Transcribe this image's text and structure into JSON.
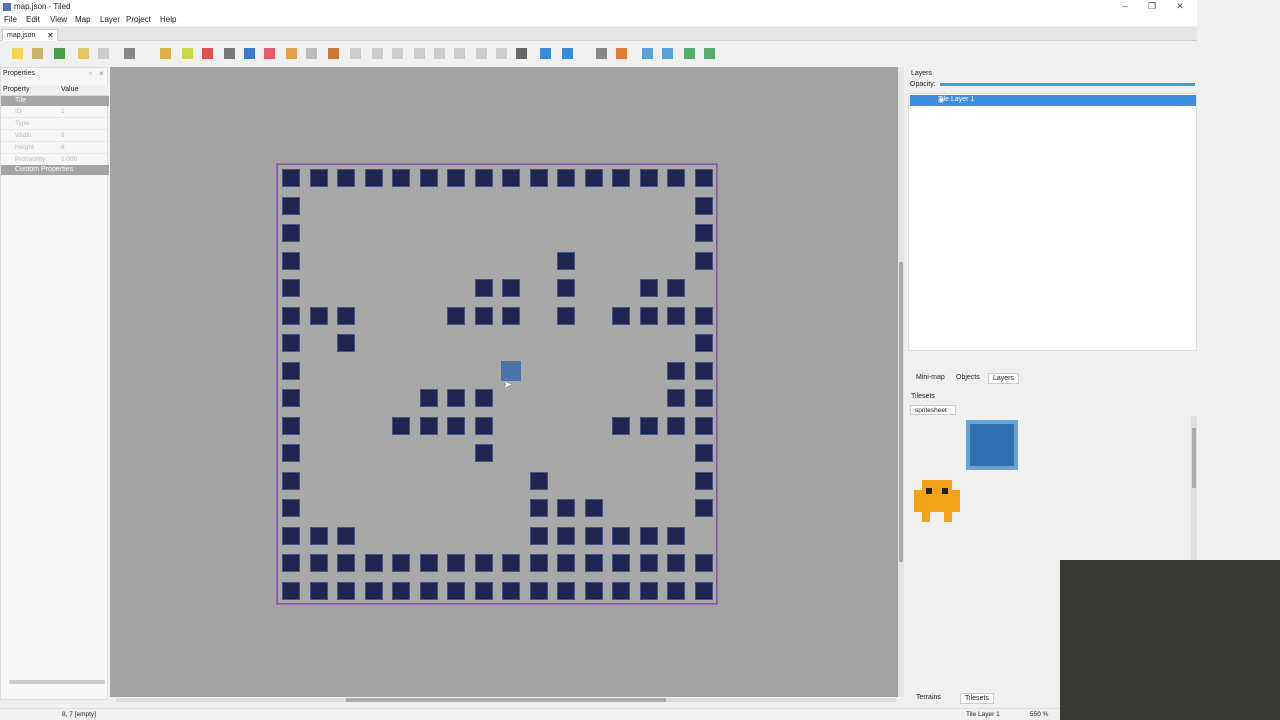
{
  "window": {
    "title": "map.json - Tiled",
    "minimize": "–",
    "restore": "❐",
    "close": "✕"
  },
  "menu": [
    "File",
    "Edit",
    "View",
    "Map",
    "Layer",
    "Project",
    "Help"
  ],
  "document_tab": {
    "label": "map.json",
    "close": "✕"
  },
  "properties": {
    "title": "Properties",
    "col_property": "Property",
    "col_value": "Value",
    "section_tile": "Tile",
    "rows": [
      {
        "k": "ID",
        "v": "1"
      },
      {
        "k": "Type",
        "v": ""
      },
      {
        "k": "Width",
        "v": "8"
      },
      {
        "k": "Height",
        "v": "8"
      },
      {
        "k": "Probability",
        "v": "1.000"
      }
    ],
    "section_custom": "Custom Properties"
  },
  "layers": {
    "title": "Layers",
    "opacity_label": "Opacity:",
    "layer_name": "Tile Layer 1",
    "tabs": [
      "Mini-map",
      "Objects",
      "Layers"
    ]
  },
  "tilesets": {
    "title": "Tilesets",
    "tab": "spritesheet",
    "bottom_tabs": [
      "Terrains",
      "Tilesets"
    ]
  },
  "status": {
    "coords": "8, 7 [empty]",
    "layer": "Tile Layer 1",
    "zoom": "550 %"
  },
  "map": {
    "rows": [
      "################",
      "#..............#",
      "#..............#",
      "#.........#....#",
      "#......##.#..##.#",
      "###...###.#.####",
      "#.#............#",
      "#.............##",
      "#....###......##",
      "#...####....####",
      "#......#.......#",
      "#........#.....#",
      "#........###...#",
      "###......######.#",
      "################",
      "################"
    ],
    "highlight": {
      "col": 8,
      "row": 7
    }
  }
}
